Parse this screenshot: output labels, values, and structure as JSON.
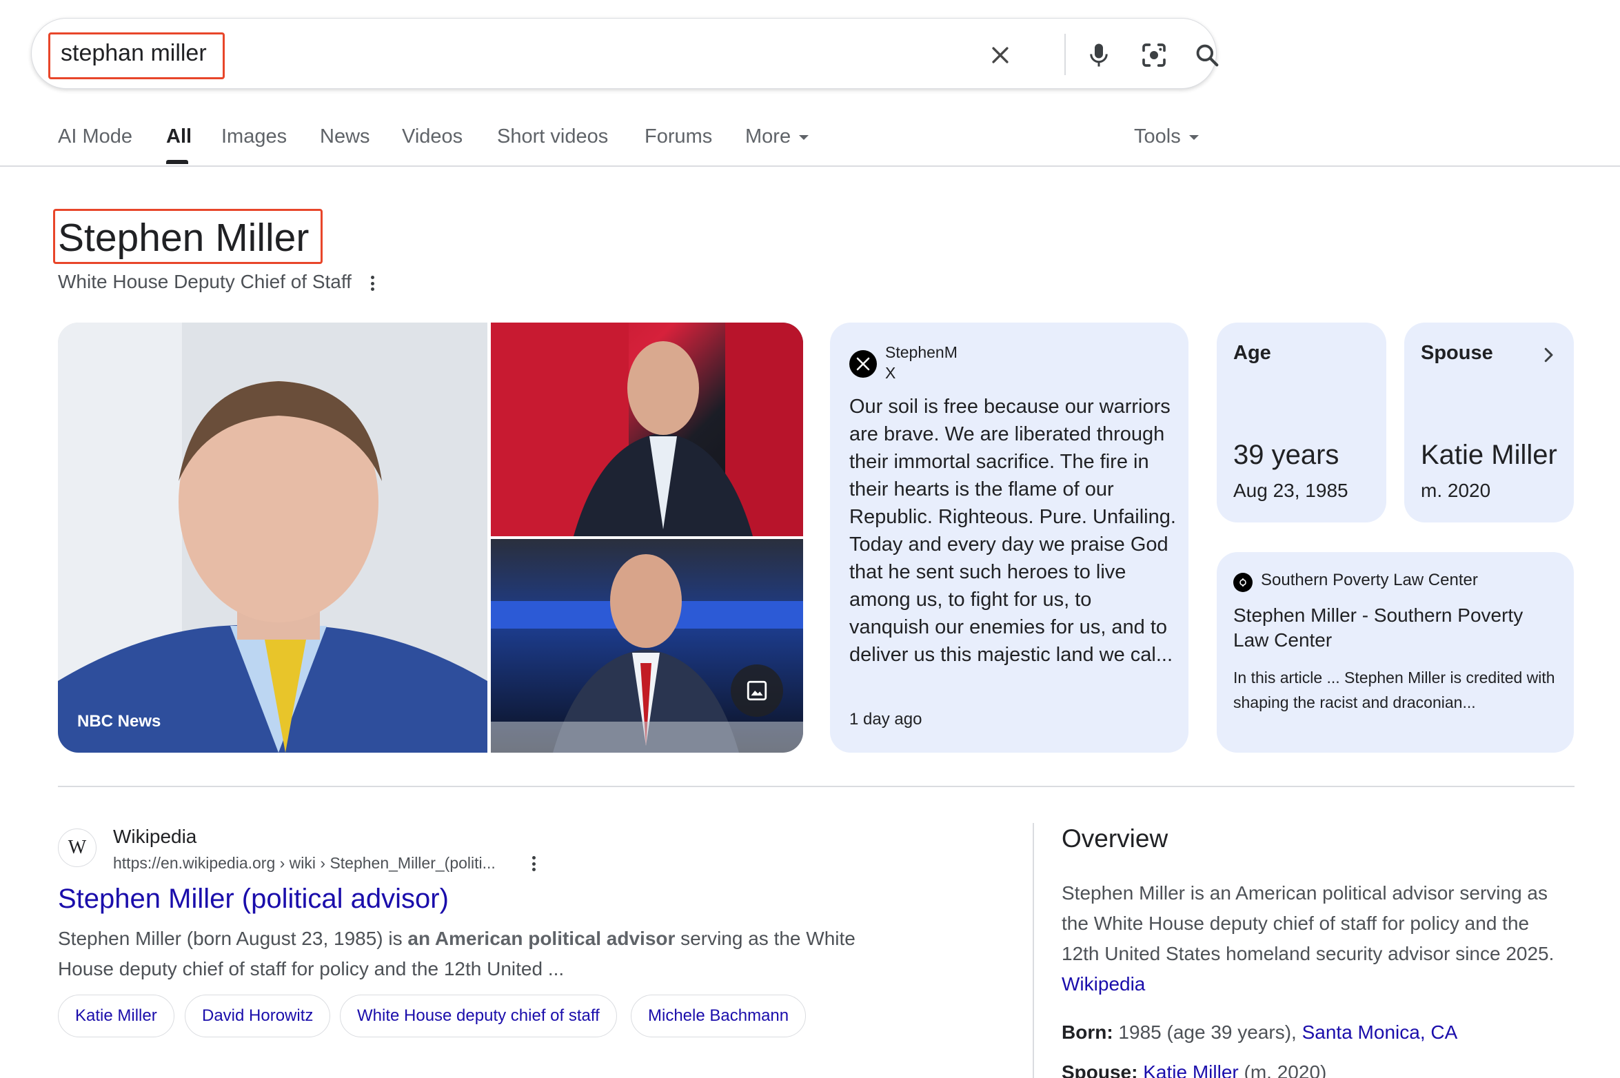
{
  "search": {
    "query": "stephan miller"
  },
  "tabs": [
    {
      "label": "AI Mode"
    },
    {
      "label": "All"
    },
    {
      "label": "Images"
    },
    {
      "label": "News"
    },
    {
      "label": "Videos"
    },
    {
      "label": "Short videos"
    },
    {
      "label": "Forums"
    },
    {
      "label": "More"
    }
  ],
  "tools_label": "Tools",
  "entity": {
    "title": "Stephen Miller",
    "subtitle": "White House Deputy Chief of Staff"
  },
  "images": {
    "caption": "NBC News"
  },
  "x_post": {
    "handle": "StephenM",
    "site": "X",
    "text": "Our soil is free because our warriors are brave. We are liberated through their immortal sacrifice. The fire in their hearts is the flame of our Republic. Righteous. Pure. Unfailing. Today and every day we praise God that he sent such heroes to live among us, to fight for us, to vanquish our enemies for us, and to deliver us this majestic land we cal...",
    "time": "1 day ago"
  },
  "age_card": {
    "label": "Age",
    "value": "39 years",
    "sub": "Aug 23, 1985"
  },
  "spouse_card": {
    "label": "Spouse",
    "value": "Katie Miller",
    "sub": "m. 2020"
  },
  "splc_card": {
    "source": "Southern Poverty Law Center",
    "title": "Stephen Miller - Southern Poverty Law Center",
    "snippet": "In this article ... Stephen Miller is credited with shaping the racist and draconian..."
  },
  "wiki_result": {
    "favicon_letter": "W",
    "site": "Wikipedia",
    "url": "https://en.wikipedia.org › wiki › Stephen_Miller_(politi...",
    "title": "Stephen Miller (political advisor)",
    "snippet_pre": "Stephen Miller (born August 23, 1985) is ",
    "snippet_bold": "an American political advisor",
    "snippet_post": " serving as the White House deputy chief of staff for policy and the 12th United ...",
    "chips": [
      "Katie Miller",
      "David Horowitz",
      "White House deputy chief of staff",
      "Michele Bachmann"
    ]
  },
  "overview": {
    "title": "Overview",
    "text": "Stephen Miller is an American political advisor serving as the White House deputy chief of staff for policy and the 12th United States homeland security advisor since 2025.",
    "source_link": "Wikipedia",
    "born_label": "Born:",
    "born_value": " 1985 (age 39 years), ",
    "born_place": "Santa Monica, CA",
    "spouse_label": "Spouse:",
    "spouse_link": "Katie Miller",
    "spouse_rest": " (m. 2020)"
  },
  "colors": {
    "link": "#1a0dab",
    "card_bg": "#e8eefc",
    "highlight_box": "#e8462a"
  }
}
